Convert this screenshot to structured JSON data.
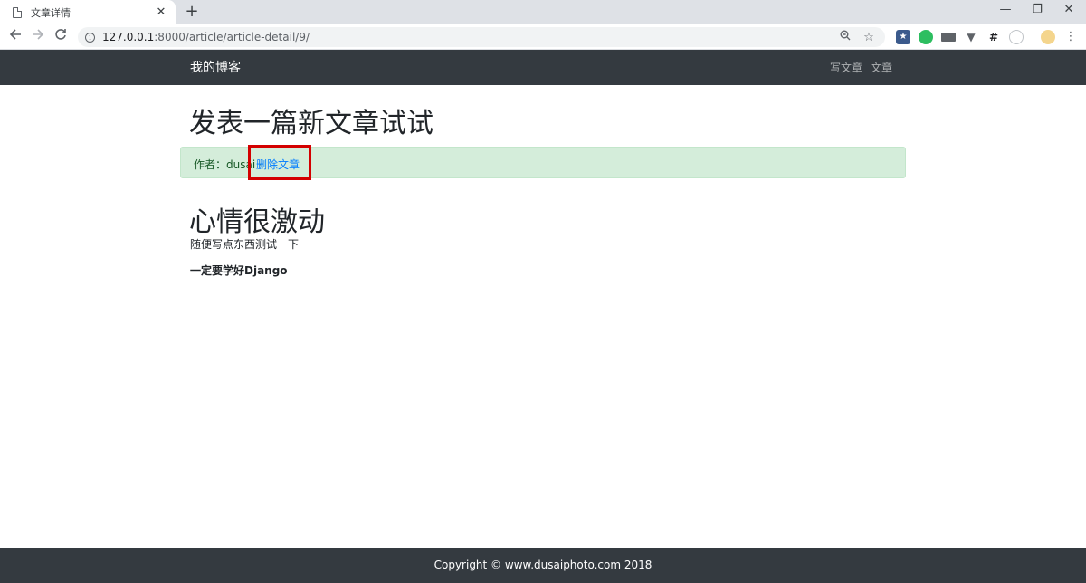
{
  "browser": {
    "tab_title": "文章详情",
    "tab_close": "✕",
    "new_tab": "+",
    "url_host": "127.0.0.1",
    "url_rest": ":8000/article/article-detail/9/",
    "window_controls": {
      "minimize": "—",
      "restore": "❐",
      "close": "✕"
    },
    "icons": [
      "back-icon",
      "forward-icon",
      "reload-icon",
      "info-icon",
      "zoom-icon",
      "star-icon"
    ]
  },
  "navbar": {
    "brand": "我的博客",
    "links": [
      "写文章",
      "文章"
    ]
  },
  "article": {
    "title": "发表一篇新文章试试",
    "author_label": "作者：dusai ·",
    "delete_link": "删除文章",
    "body_heading": "心情很激动",
    "body_text": "随便写点东西测试一下",
    "body_strong": "一定要学好Django"
  },
  "footer": {
    "copyright": "Copyright © www.dusaiphoto.com 2018"
  },
  "colors": {
    "navbar_bg": "#343a40",
    "alert_bg": "#d4edda",
    "link": "#007bff",
    "highlight": "#d40000"
  }
}
